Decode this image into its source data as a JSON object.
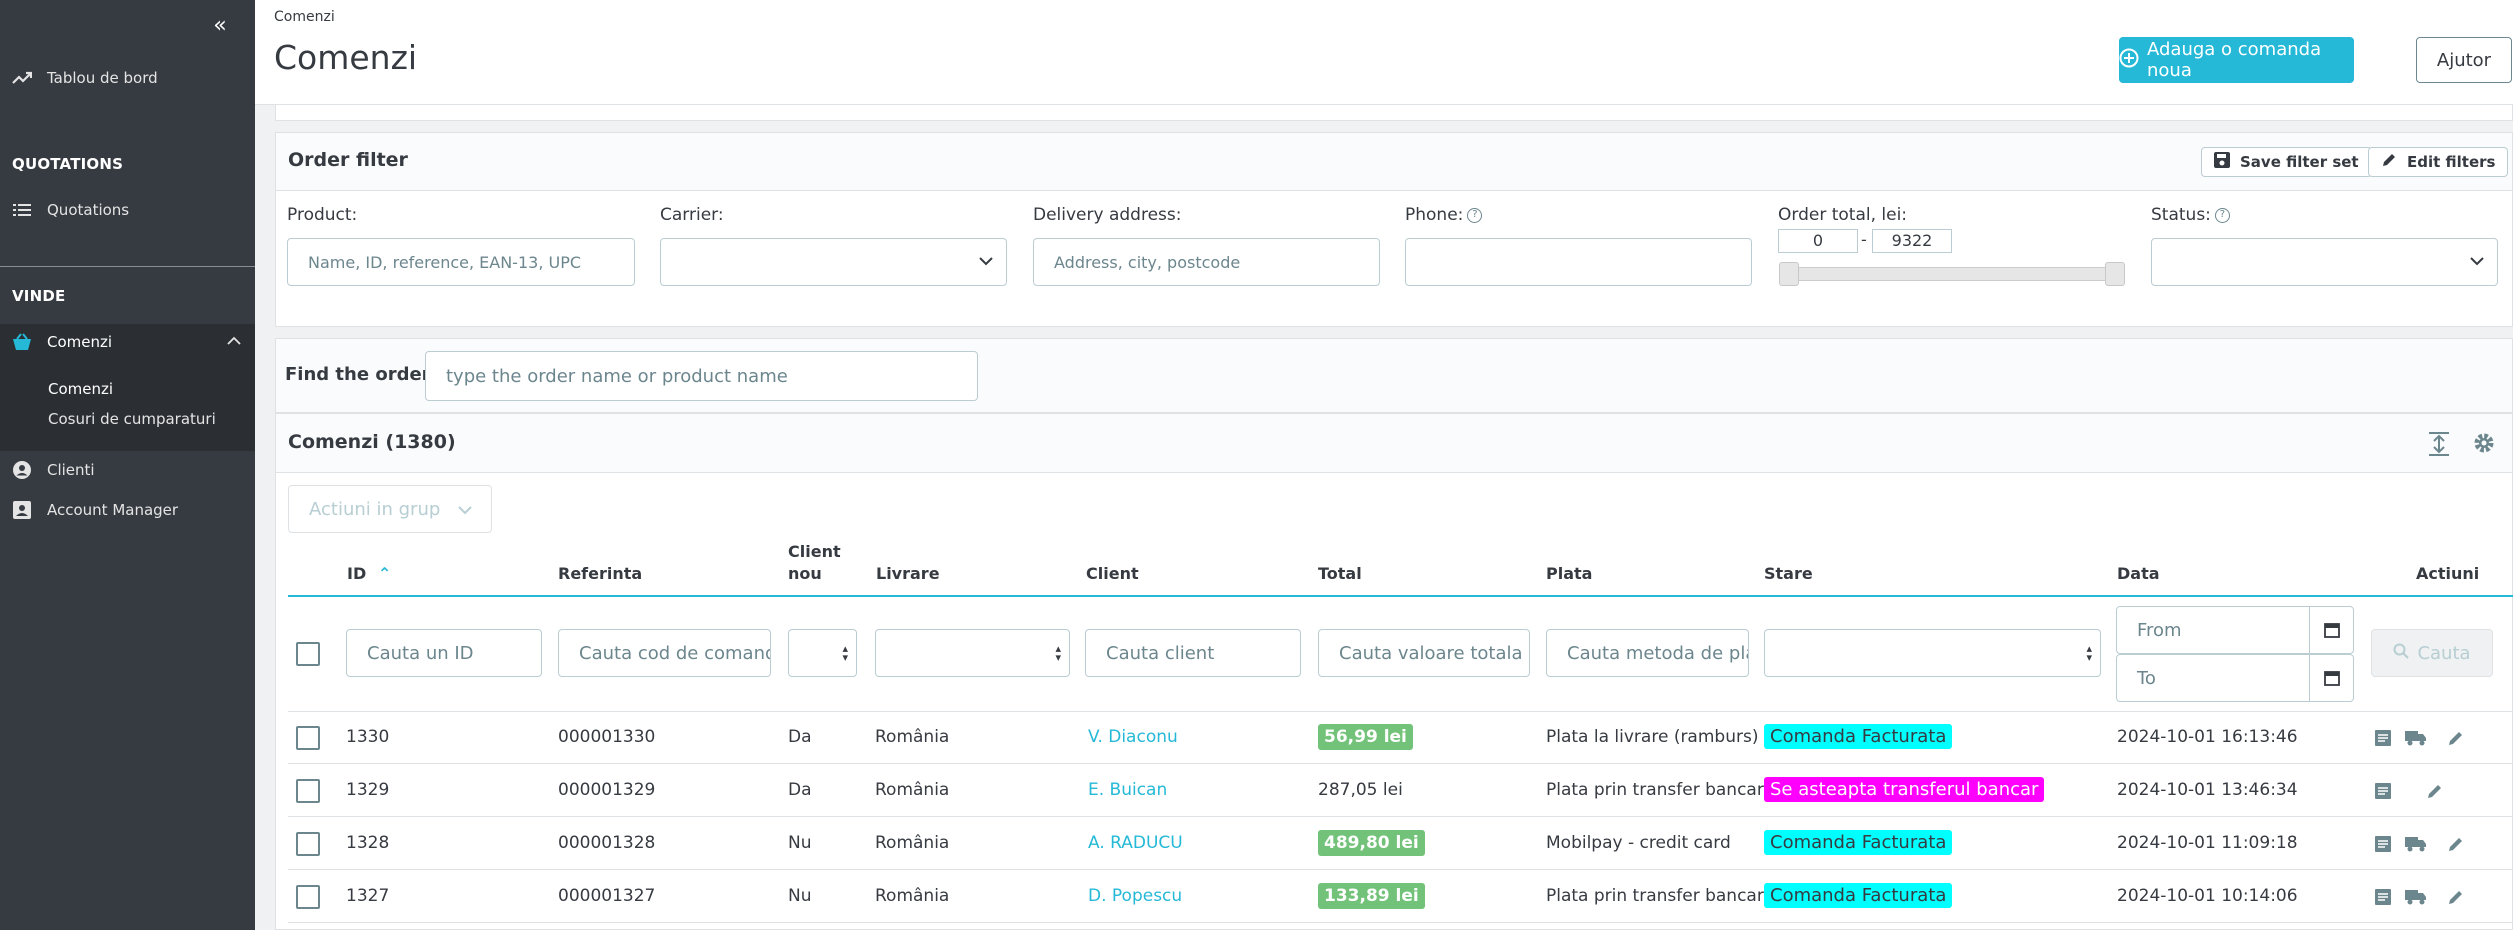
{
  "sidebar": {
    "dashboard": "Tablou de bord",
    "section_quotations": "QUOTATIONS",
    "quotations": "Quotations",
    "section_sell": "VINDE",
    "orders": "Comenzi",
    "sub_orders": "Comenzi",
    "sub_carts": "Cosuri de cumparaturi",
    "clients": "Clienti",
    "account_manager": "Account Manager"
  },
  "header": {
    "breadcrumb": "Comenzi",
    "title": "Comenzi",
    "add_order": "Adauga o comanda noua",
    "help": "Ajutor"
  },
  "order_filter": {
    "title": "Order filter",
    "save_filter": "Save filter set",
    "edit_filters": "Edit filters",
    "product_label": "Product:",
    "product_placeholder": "Name, ID, reference, EAN-13, UPC",
    "carrier_label": "Carrier:",
    "delivery_label": "Delivery address:",
    "delivery_placeholder": "Address, city, postcode",
    "phone_label": "Phone:",
    "total_label": "Order total, lei:",
    "total_min": "0",
    "total_max": "9322",
    "status_label": "Status:"
  },
  "find": {
    "label": "Find the order",
    "placeholder": "type the order name or product name"
  },
  "orders": {
    "title": "Comenzi (1380)",
    "bulk_actions": "Actiuni in grup",
    "columns": {
      "id": "ID",
      "reference": "Referinta",
      "new_client_1": "Client",
      "new_client_2": "nou",
      "delivery": "Livrare",
      "client": "Client",
      "total": "Total",
      "payment": "Plata",
      "status": "Stare",
      "date": "Data",
      "actions": "Actiuni"
    },
    "filters": {
      "id": "Cauta un ID",
      "reference": "Cauta cod de comanda",
      "client": "Cauta client",
      "total": "Cauta valoare totala",
      "payment": "Cauta metoda de plata",
      "date_from": "From",
      "date_to": "To",
      "search": "Cauta"
    },
    "rows": [
      {
        "id": "1330",
        "reference": "000001330",
        "new_client": "Da",
        "delivery": "România",
        "client": "V. Diaconu",
        "total": "56,99 lei",
        "total_badge": true,
        "payment": "Plata la livrare (ramburs)",
        "status": "Comanda Facturata",
        "status_color": "#00ffff",
        "status_text_color": "#363a41",
        "date": "2024-10-01 16:13:46",
        "shipping": true
      },
      {
        "id": "1329",
        "reference": "000001329",
        "new_client": "Da",
        "delivery": "România",
        "client": "E. Buican",
        "total": "287,05 lei",
        "total_badge": false,
        "payment": "Plata prin transfer bancar",
        "status": "Se asteapta transferul bancar",
        "status_color": "#ff00ff",
        "status_text_color": "#ffffff",
        "date": "2024-10-01 13:46:34",
        "shipping": false
      },
      {
        "id": "1328",
        "reference": "000001328",
        "new_client": "Nu",
        "delivery": "România",
        "client": "A. RADUCU",
        "total": "489,80 lei",
        "total_badge": true,
        "payment": "Mobilpay - credit card",
        "status": "Comanda Facturata",
        "status_color": "#00ffff",
        "status_text_color": "#363a41",
        "date": "2024-10-01 11:09:18",
        "shipping": true
      },
      {
        "id": "1327",
        "reference": "000001327",
        "new_client": "Nu",
        "delivery": "România",
        "client": "D. Popescu",
        "total": "133,89 lei",
        "total_badge": true,
        "payment": "Plata prin transfer bancar",
        "status": "Comanda Facturata",
        "status_color": "#00ffff",
        "status_text_color": "#363a41",
        "date": "2024-10-01 10:14:06",
        "shipping": true
      }
    ]
  },
  "colors": {
    "accent": "#25b9d7",
    "sidebar_bg": "#363a41",
    "paid_badge": "#72c279"
  }
}
